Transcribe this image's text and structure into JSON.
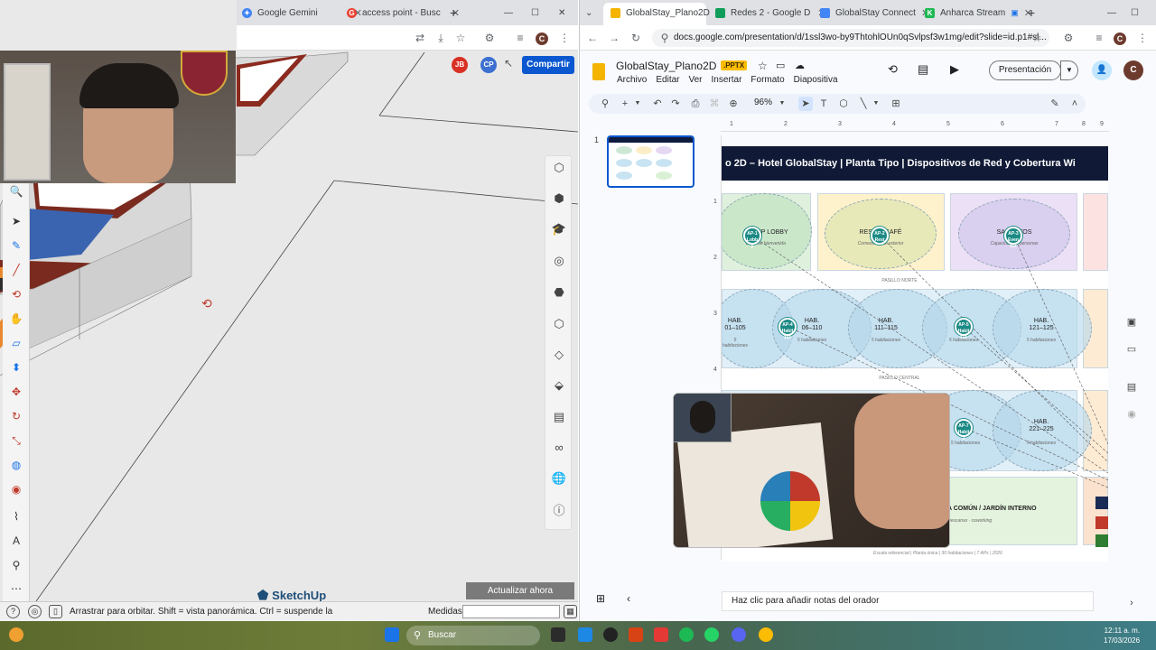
{
  "left_browser": {
    "tabs": [
      {
        "label": "Google Gemini",
        "icon": "gemini-icon"
      },
      {
        "label": "access point - Busc",
        "icon": "google-icon"
      }
    ]
  },
  "meet": {
    "avatars": [
      "JB",
      "CP"
    ],
    "share_label": "Compartir"
  },
  "sketchup": {
    "logo": "SketchUp",
    "update_button": "Actualizar ahora",
    "status_message": "Arrastrar para orbitar. Shift = vista panorámica. Ctrl = suspende la",
    "measures_label": "Medidas"
  },
  "right_browser": {
    "tabs": [
      {
        "label": "GlobalStay_Plano2D",
        "icon": "slides-icon"
      },
      {
        "label": "Redes 2 - Google D",
        "icon": "drive-icon"
      },
      {
        "label": "GlobalStay Connect",
        "icon": "docs-icon"
      },
      {
        "label": "Anharca Stream",
        "icon": "stream-icon"
      }
    ],
    "url": "docs.google.com/presentation/d/1ssl3wo-by9ThtohlOUn0qSvlpsf3w1mg/edit?slide=id.p1#sl..."
  },
  "slides": {
    "doc_title": "GlobalStay_Plano2D",
    "badge": ".PPTX",
    "menu": [
      "Archivo",
      "Editar",
      "Ver",
      "Insertar",
      "Formato",
      "Diapositiva"
    ],
    "present_label": "Presentación",
    "avatar": "C",
    "zoom": "96%",
    "slide_number": "1",
    "ruler_h": [
      "1",
      "2",
      "3",
      "4",
      "5",
      "6",
      "7",
      "8",
      "9"
    ],
    "ruler_v": [
      "1",
      "2",
      "3",
      "4"
    ],
    "notes_placeholder": "Haz clic para añadir notas del orador"
  },
  "slide": {
    "title": "o 2D – Hotel GlobalStay  |  Planta Tipo  |  Dispositivos de Red y Cobertura Wi",
    "zones_top": [
      {
        "label": "RECEP    LOBBY",
        "sub": "Zona de bienvenida"
      },
      {
        "label": "RESTA      / CAFÉ",
        "sub": "Comedor · Bar exterior"
      },
      {
        "label": "SALA        NTOS",
        "sub": "Capacidad 80 personas"
      }
    ],
    "corridor_north": "PASILLO NORTE",
    "rooms_mid": [
      {
        "label": "HAB.\n01–105",
        "sub": "5 habitaciones"
      },
      {
        "label": "HAB.\n06–110",
        "sub": "5 habitaciones"
      },
      {
        "label": "HAB.\n111–115",
        "sub": "5 habitaciones"
      },
      {
        "label": "",
        "sub": "5 habitaciones"
      },
      {
        "label": "HAB.\n121–125",
        "sub": "5 habitaciones"
      }
    ],
    "corridor_central": "PASILLO CENTRAL",
    "rooms_low": [
      {
        "label": "",
        "sub": "5 habitaciones"
      },
      {
        "label": "HAB.\n221–225",
        "sub": "5 habitaciones"
      }
    ],
    "common_area": {
      "label": "A COMÚN / JARDÍN INTERNO",
      "sub": "Descanso · coworking"
    },
    "ap_labels": [
      "AP-1 Lobb y",
      "AP-2 Rest",
      "AP-3 Even tos",
      "AP-4 Habit 101",
      "AP-5 Habit 111",
      "AP-7 Habit 2"
    ],
    "footer": "Escala referencial  |  Planta única  |  30 habitaciones  |  7 APs  |  2026"
  },
  "taskbar": {
    "search_placeholder": "Buscar",
    "time": "12:11 a. m.",
    "date": "17/03/2026"
  },
  "colors": {
    "accent": "#0b57d0",
    "ap": "#1c8a85",
    "slide_header": "#101a36"
  }
}
